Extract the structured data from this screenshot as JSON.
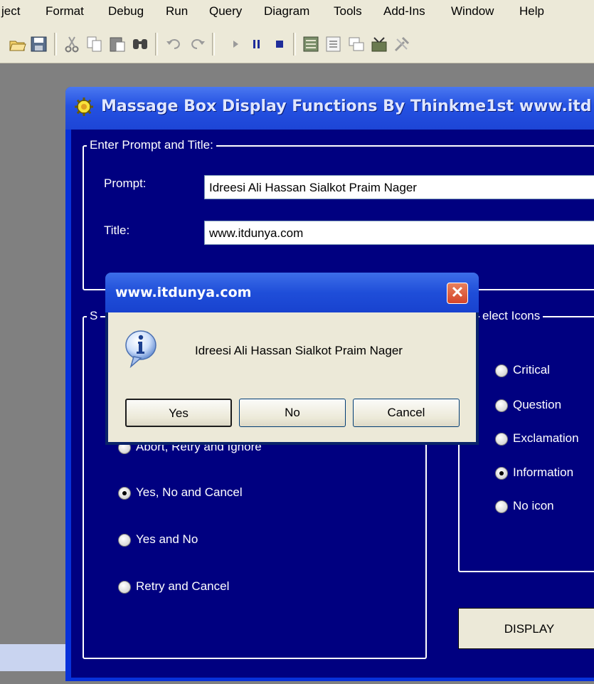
{
  "menubar": {
    "items": [
      {
        "label": "ject"
      },
      {
        "label": "Format"
      },
      {
        "label": "Debug"
      },
      {
        "label": "Run"
      },
      {
        "label": "Query"
      },
      {
        "label": "Diagram"
      },
      {
        "label": "Tools"
      },
      {
        "label": "Add-Ins"
      },
      {
        "label": "Window"
      },
      {
        "label": "Help"
      }
    ]
  },
  "toolbar": {
    "icons": [
      "open-icon",
      "save-icon",
      "cut-icon",
      "copy-icon",
      "paste-icon",
      "find-icon",
      "undo-icon",
      "redo-icon",
      "run-icon",
      "pause-icon",
      "stop-icon",
      "project-explorer-icon",
      "properties-icon",
      "form-layout-icon",
      "object-browser-icon",
      "toolbox-icon"
    ]
  },
  "form": {
    "title": "Massage Box Display Functions  By Thinkme1st www.itd",
    "prompt_frame": {
      "legend": "Enter Prompt and Title:",
      "prompt_label": "Prompt:",
      "prompt_value": "Idreesi Ali Hassan  Sialkot Praim Nager",
      "title_label": "Title:",
      "title_value": "www.itdunya.com"
    },
    "buttons_frame": {
      "legend": "S",
      "options": [
        {
          "label": "Abort, Retry and Ignore",
          "selected": false
        },
        {
          "label": "Yes, No and Cancel",
          "selected": true
        },
        {
          "label": "Yes and No",
          "selected": false
        },
        {
          "label": "Retry and Cancel",
          "selected": false
        }
      ]
    },
    "icons_frame": {
      "legend": "elect Icons",
      "options": [
        {
          "label": "Critical",
          "selected": false
        },
        {
          "label": "Question",
          "selected": false
        },
        {
          "label": "Exclamation",
          "selected": false
        },
        {
          "label": "Information",
          "selected": true
        },
        {
          "label": "No icon",
          "selected": false
        }
      ]
    },
    "display_button": "DISPLAY"
  },
  "msgbox": {
    "title": "www.itdunya.com",
    "message": "Idreesi Ali Hassan  Sialkot Praim Nager",
    "icon": "information-icon",
    "buttons": [
      {
        "label": "Yes",
        "default": true
      },
      {
        "label": "No",
        "default": false
      },
      {
        "label": "Cancel",
        "default": false
      }
    ]
  },
  "colors": {
    "form_client": "#000080",
    "xp_title_blue": "#0831d9",
    "dialog_face": "#ece9d8",
    "close_red": "#d4452a"
  }
}
